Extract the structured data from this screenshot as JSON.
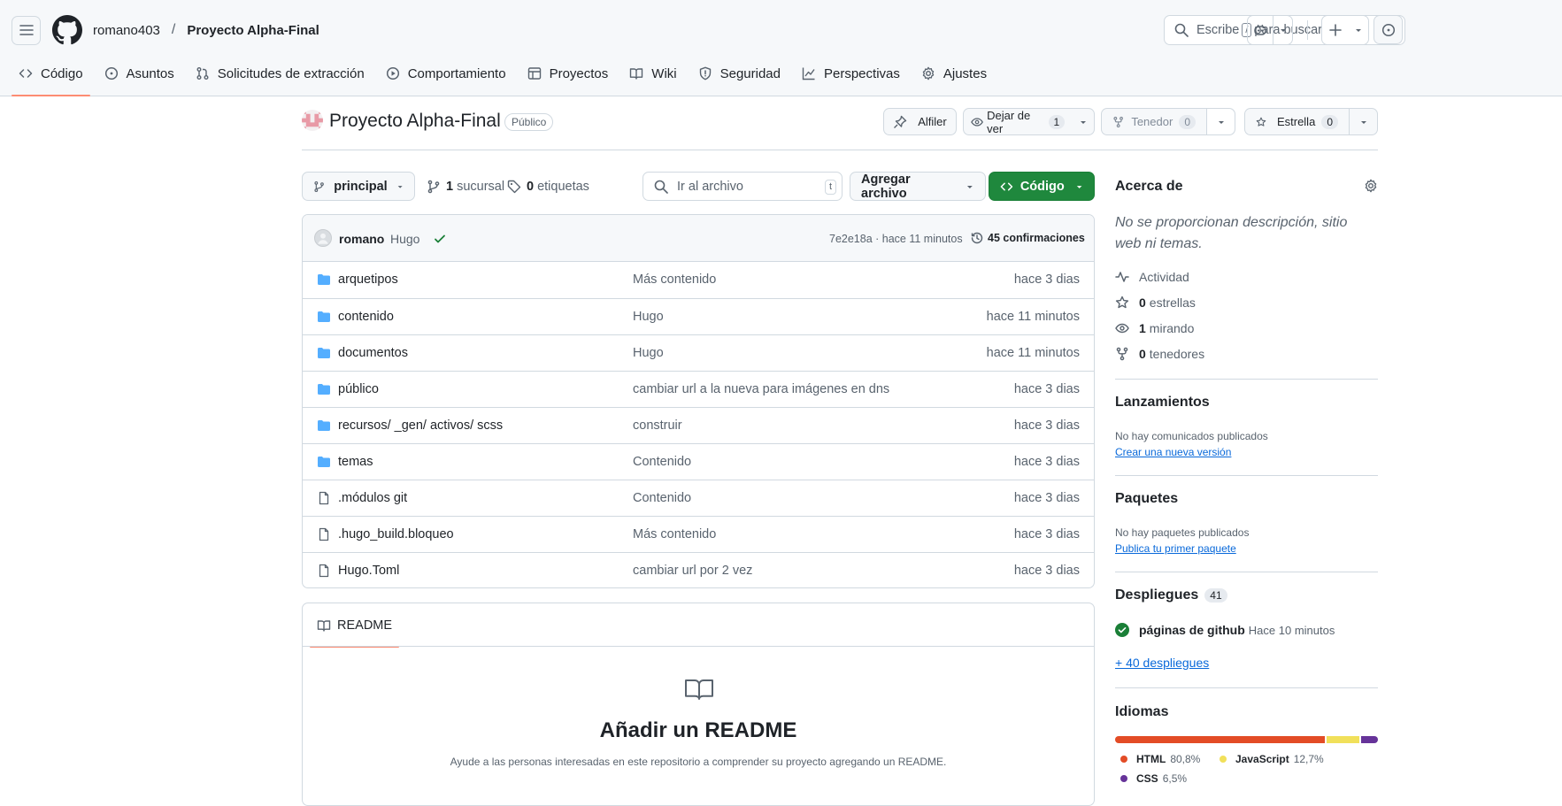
{
  "nav": {
    "owner": "romano403",
    "separator": "/",
    "repo": "Proyecto Alpha-Final",
    "search_pre": "Escribe",
    "search_key": "/",
    "search_post": "para buscar"
  },
  "tabs": [
    {
      "label": "Código",
      "icon": "code-icon"
    },
    {
      "label": "Asuntos",
      "icon": "issue-icon"
    },
    {
      "label": "Solicitudes de extracción",
      "icon": "pull-request-icon"
    },
    {
      "label": "Comportamiento",
      "icon": "play-icon"
    },
    {
      "label": "Proyectos",
      "icon": "table-icon"
    },
    {
      "label": "Wiki",
      "icon": "book-icon"
    },
    {
      "label": "Seguridad",
      "icon": "shield-icon"
    },
    {
      "label": "Perspectivas",
      "icon": "graph-icon"
    },
    {
      "label": "Ajustes",
      "icon": "gear-icon"
    }
  ],
  "repo": {
    "name": "Proyecto Alpha-Final",
    "visibility": "Público",
    "pin": "Alfiler",
    "watch": "Dejar de ver",
    "watch_count": "1",
    "fork": "Tenedor",
    "fork_count": "0",
    "star": "Estrella",
    "star_count": "0"
  },
  "toolbar": {
    "branch": "principal",
    "branches_count": "1",
    "branches_label": "sucursal",
    "tags_count": "0",
    "tags_label": "etiquetas",
    "goto_placeholder": "Ir al archivo",
    "goto_key": "t",
    "add_file": "Agregar archivo",
    "code": "Código"
  },
  "commit": {
    "author": "romano",
    "message": "Hugo",
    "hash_time": "7e2e18a · hace 11 minutos",
    "commits": "45 confirmaciones"
  },
  "files": [
    {
      "name": "arquetipos",
      "type": "dir",
      "message": "Más contenido",
      "date": "hace 3 dias"
    },
    {
      "name": "contenido",
      "type": "dir",
      "message": "Hugo",
      "date": "hace 11 minutos"
    },
    {
      "name": "documentos",
      "type": "dir",
      "message": "Hugo",
      "date": "hace 11 minutos"
    },
    {
      "name": "público",
      "type": "dir",
      "message": "cambiar url a la nueva para imágenes en dns",
      "date": "hace 3 dias"
    },
    {
      "name": "recursos/ _gen/ activos/ scss",
      "type": "dir",
      "message": "construir",
      "date": "hace 3 dias"
    },
    {
      "name": "temas",
      "type": "dir",
      "message": "Contenido",
      "date": "hace 3 dias"
    },
    {
      "name": ".módulos git",
      "type": "file",
      "message": "Contenido",
      "date": "hace 3 dias"
    },
    {
      "name": ".hugo_build.bloqueo",
      "type": "file",
      "message": "Más contenido",
      "date": "hace 3 dias"
    },
    {
      "name": "Hugo.Toml",
      "type": "file",
      "message": "cambiar url por 2 vez",
      "date": "hace 3 dias"
    }
  ],
  "readme": {
    "tab": "README",
    "title": "Añadir un README",
    "text": "Ayude a las personas interesadas en este repositorio a comprender su proyecto agregando un README."
  },
  "about": {
    "title": "Acerca de",
    "description": "No se proporcionan descripción, sitio web ni temas.",
    "activity": "Actividad",
    "stars_count": "0",
    "stars_label": "estrellas",
    "watching_count": "1",
    "watching_label": "mirando",
    "forks_count": "0",
    "forks_label": "tenedores"
  },
  "releases": {
    "title": "Lanzamientos",
    "empty": "No hay comunicados publicados",
    "link": "Crear una nueva versión"
  },
  "packages": {
    "title": "Paquetes",
    "empty": "No hay paquetes publicados",
    "link": "Publica tu primer paquete"
  },
  "deployments": {
    "title": "Despliegues",
    "count": "41",
    "item": "páginas de github",
    "item_time": "Hace 10 minutos",
    "more": "+ 40 despliegues"
  },
  "languages": {
    "title": "Idiomas",
    "items": [
      {
        "name": "HTML",
        "percent": "80,8%",
        "value": 80.8,
        "color": "#e34c26"
      },
      {
        "name": "JavaScript",
        "percent": "12,7%",
        "value": 12.7,
        "color": "#f1e05a"
      },
      {
        "name": "CSS",
        "percent": "6,5%",
        "value": 6.5,
        "color": "#663399"
      }
    ]
  },
  "colors": {
    "accent_underline": "#fd8c73",
    "green_button": "#1f883d",
    "folder": "#54aeff",
    "link": "#0969da"
  }
}
